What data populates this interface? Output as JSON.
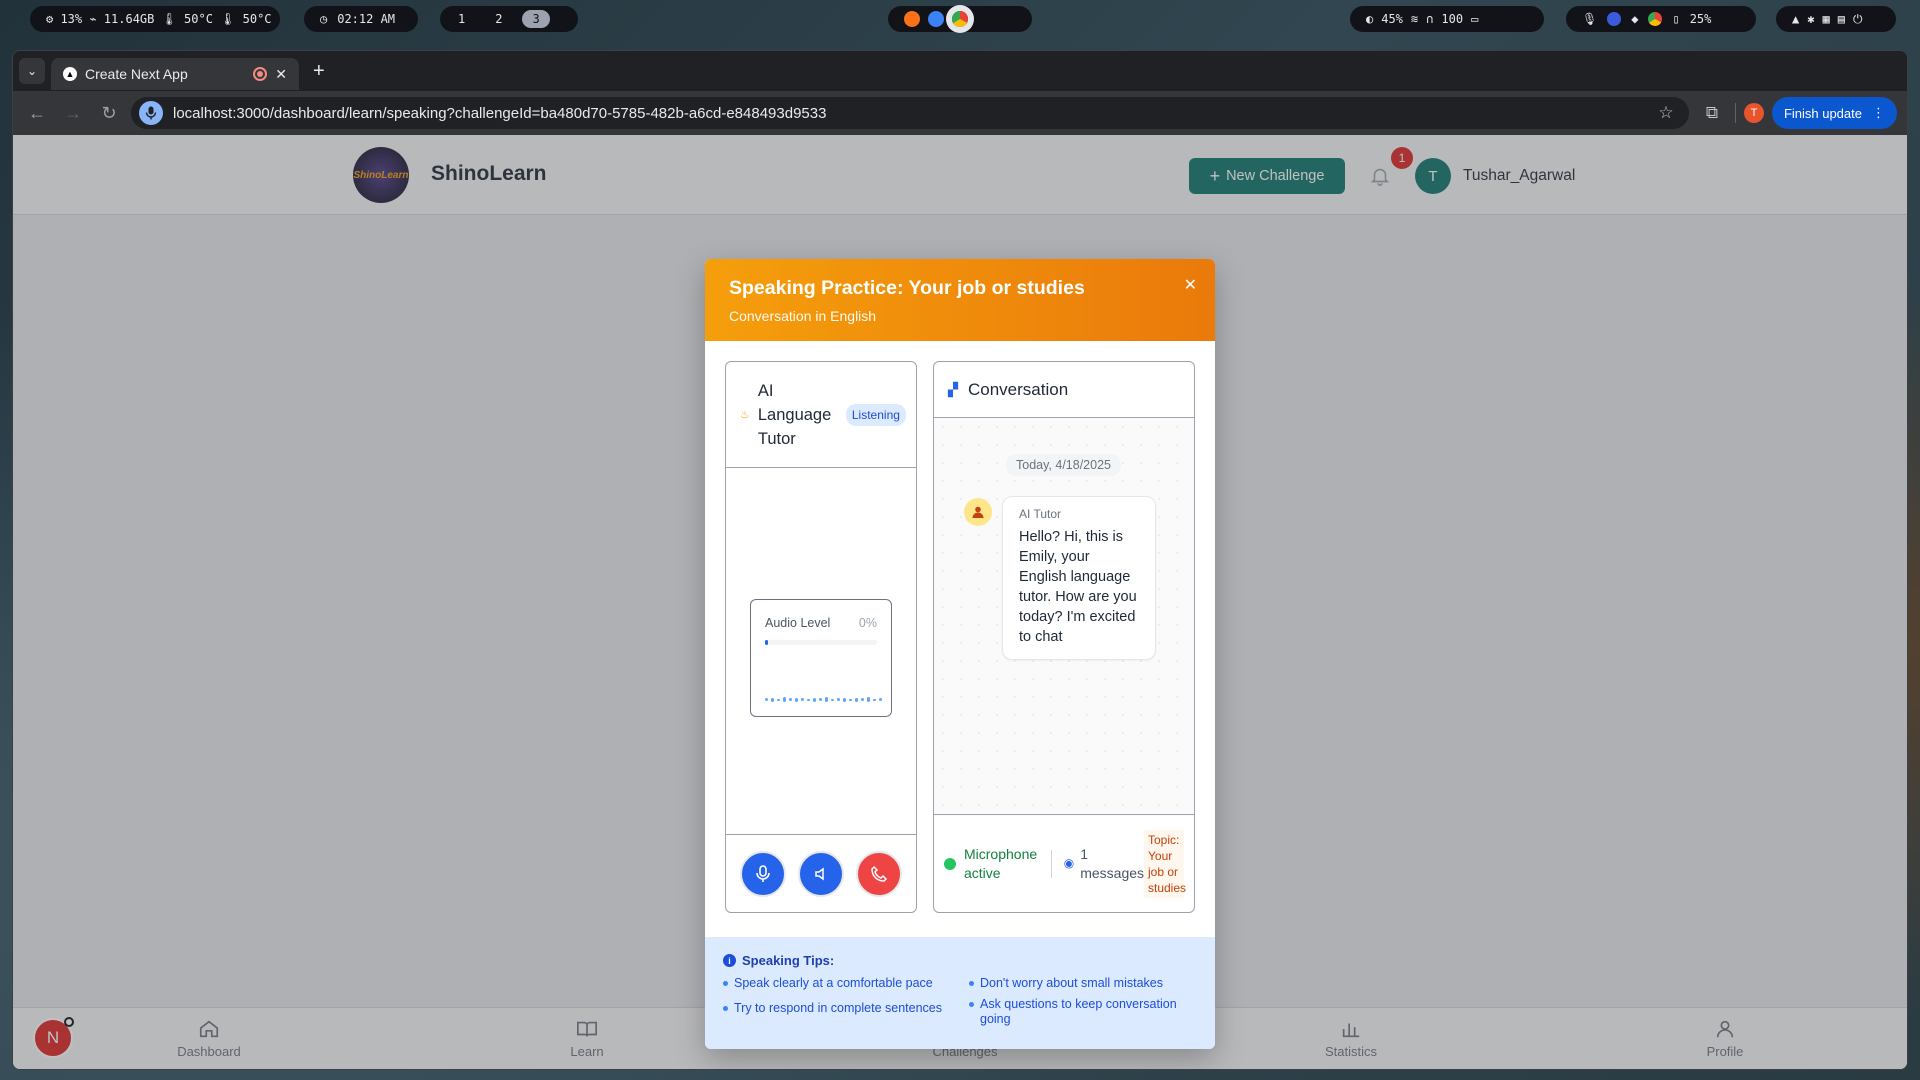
{
  "system_bar": {
    "stats": "⚙ 13%  ⌁ 11.64GB  🌡 50°C  🌡 50°C",
    "clock": "02:12 AM",
    "workspaces": [
      "1",
      "2",
      "3"
    ],
    "active_workspace": "3",
    "brightness": "45%",
    "volume": "100",
    "battery": "25%"
  },
  "browser": {
    "tab_title": "Create Next App",
    "url": "localhost:3000/dashboard/learn/speaking?challengeId=ba480d70-5785-482b-a6cd-e848493d9533",
    "finish_update_label": "Finish update",
    "profile_initial": "T"
  },
  "app": {
    "brand": "ShinoLearn",
    "logo_text": "ShinoLearn",
    "new_challenge_label": "New Challenge",
    "notification_count": "1",
    "user_initial": "T",
    "username": "Tushar_Agarwal"
  },
  "bottom_nav": {
    "badge_initial": "N",
    "items": [
      {
        "label": "Dashboard",
        "icon": "home-icon"
      },
      {
        "label": "Learn",
        "icon": "book-icon"
      },
      {
        "label": "Challenges",
        "icon": "layers-icon"
      },
      {
        "label": "Statistics",
        "icon": "bar-chart-icon"
      },
      {
        "label": "Profile",
        "icon": "user-icon"
      }
    ]
  },
  "modal": {
    "title": "Speaking Practice: Your job or studies",
    "subtitle": "Conversation in English",
    "tutor": {
      "name": "AI Language Tutor",
      "status": "Listening",
      "audio_label": "Audio Level",
      "audio_percent": "0%",
      "audio_level": 0
    },
    "conversation": {
      "title": "Conversation",
      "date": "Today, 4/18/2025",
      "messages": [
        {
          "sender": "AI Tutor",
          "text": "Hello? Hi, this is Emily, your English language tutor. How are you today? I'm excited to chat"
        }
      ],
      "mic_status": "Microphone active",
      "message_count": "1 messages",
      "topic": "Topic: Your job or studies"
    },
    "tips": {
      "title": "Speaking Tips:",
      "items": [
        "Speak clearly at a comfortable pace",
        "Don't worry about small mistakes",
        "Try to respond in complete sentences",
        "Ask questions to keep conversation going"
      ]
    }
  },
  "colors": {
    "accent_teal": "#0f766e",
    "modal_header_orange": "#f59e0b",
    "control_blue": "#2563eb",
    "hangup_red": "#ef4444"
  }
}
